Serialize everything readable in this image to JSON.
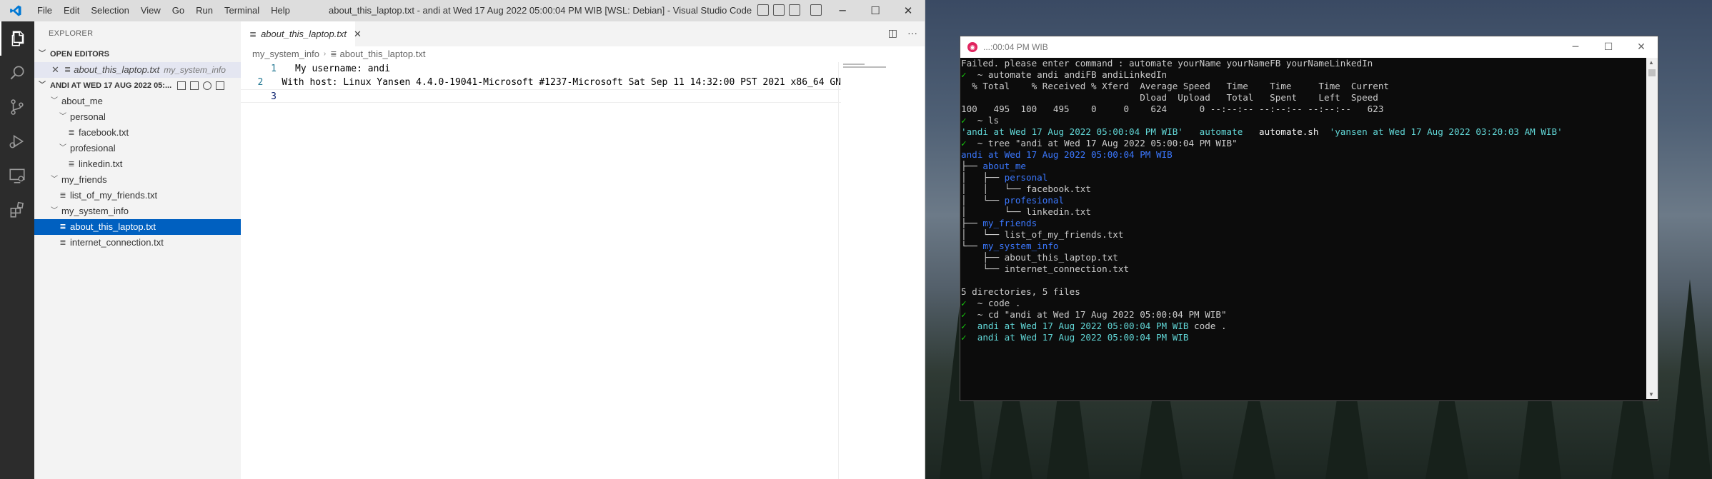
{
  "vscode": {
    "title": "about_this_laptop.txt - andi at Wed 17 Aug 2022 05:00:04 PM WIB [WSL: Debian] - Visual Studio Code",
    "menu": [
      "File",
      "Edit",
      "Selection",
      "View",
      "Go",
      "Run",
      "Terminal",
      "Help"
    ],
    "sidebar": {
      "header": "EXPLORER",
      "open_editors_label": "OPEN EDITORS",
      "open_editor": {
        "name": "about_this_laptop.txt",
        "desc": "my_system_info"
      },
      "folder_label": "ANDI AT WED 17 AUG 2022 05:...",
      "tree": [
        {
          "label": "about_me",
          "type": "folder",
          "depth": 1
        },
        {
          "label": "personal",
          "type": "folder",
          "depth": 2
        },
        {
          "label": "facebook.txt",
          "type": "file",
          "depth": 3
        },
        {
          "label": "profesional",
          "type": "folder",
          "depth": 2
        },
        {
          "label": "linkedin.txt",
          "type": "file",
          "depth": 3
        },
        {
          "label": "my_friends",
          "type": "folder",
          "depth": 1
        },
        {
          "label": "list_of_my_friends.txt",
          "type": "file",
          "depth": 2
        },
        {
          "label": "my_system_info",
          "type": "folder",
          "depth": 1
        },
        {
          "label": "about_this_laptop.txt",
          "type": "file",
          "depth": 2,
          "selected": true
        },
        {
          "label": "internet_connection.txt",
          "type": "file",
          "depth": 2
        }
      ]
    },
    "editor": {
      "tab_label": "about_this_laptop.txt",
      "breadcrumb": [
        "my_system_info",
        "about_this_laptop.txt"
      ],
      "lines": [
        {
          "num": "1",
          "text": "My username: andi"
        },
        {
          "num": "2",
          "text": "With host: Linux Yansen 4.4.0-19041-Microsoft #1237-Microsoft Sat Sep 11 14:32:00 PST 2021 x86_64 GN"
        },
        {
          "num": "3",
          "text": ""
        }
      ]
    }
  },
  "terminal": {
    "title": "...:00:04 PM WIB",
    "lines": [
      [
        {
          "t": "Failed. please enter command : automate yourName yourNameFB yourNameLinkedIn",
          "c": ""
        }
      ],
      [
        {
          "t": "✓",
          "c": "g"
        },
        {
          "t": "  ~ automate andi andiFB andiLinkedIn",
          "c": ""
        }
      ],
      [
        {
          "t": "  % Total    % Received % Xferd  Average Speed   Time    Time     Time  Current",
          "c": ""
        }
      ],
      [
        {
          "t": "                                 Dload  Upload   Total   Spent    Left  Speed",
          "c": ""
        }
      ],
      [
        {
          "t": "100   495  100   495    0     0    624      0 --:--:-- --:--:-- --:--:--   623",
          "c": ""
        }
      ],
      [
        {
          "t": "✓",
          "c": "g"
        },
        {
          "t": "  ~ ls",
          "c": ""
        }
      ],
      [
        {
          "t": "'andi at Wed 17 Aug 2022 05:00:04 PM WIB'",
          "c": "c"
        },
        {
          "t": "   ",
          "c": ""
        },
        {
          "t": "automate",
          "c": "c"
        },
        {
          "t": "   automate.sh  ",
          "c": "w"
        },
        {
          "t": "'yansen at Wed 17 Aug 2022 03:20:03 AM WIB'",
          "c": "c"
        }
      ],
      [
        {
          "t": "✓",
          "c": "g"
        },
        {
          "t": "  ~ tree \"andi at Wed 17 Aug 2022 05:00:04 PM WIB\"",
          "c": ""
        }
      ],
      [
        {
          "t": "andi at Wed 17 Aug 2022 05:00:04 PM WIB",
          "c": "b"
        }
      ],
      [
        {
          "t": "├── ",
          "c": ""
        },
        {
          "t": "about_me",
          "c": "b"
        }
      ],
      [
        {
          "t": "│   ├── ",
          "c": ""
        },
        {
          "t": "personal",
          "c": "b"
        }
      ],
      [
        {
          "t": "│   │   └── facebook.txt",
          "c": ""
        }
      ],
      [
        {
          "t": "│   └── ",
          "c": ""
        },
        {
          "t": "profesional",
          "c": "b"
        }
      ],
      [
        {
          "t": "│       └── linkedin.txt",
          "c": ""
        }
      ],
      [
        {
          "t": "├── ",
          "c": ""
        },
        {
          "t": "my_friends",
          "c": "b"
        }
      ],
      [
        {
          "t": "│   └── list_of_my_friends.txt",
          "c": ""
        }
      ],
      [
        {
          "t": "└── ",
          "c": ""
        },
        {
          "t": "my_system_info",
          "c": "b"
        }
      ],
      [
        {
          "t": "    ├── about_this_laptop.txt",
          "c": ""
        }
      ],
      [
        {
          "t": "    └── internet_connection.txt",
          "c": ""
        }
      ],
      [
        {
          "t": "",
          "c": ""
        }
      ],
      [
        {
          "t": "5 directories, 5 files",
          "c": ""
        }
      ],
      [
        {
          "t": "✓",
          "c": "g"
        },
        {
          "t": "  ~ code .",
          "c": ""
        }
      ],
      [
        {
          "t": "✓",
          "c": "g"
        },
        {
          "t": "  ~ cd \"andi at Wed 17 Aug 2022 05:00:04 PM WIB\"",
          "c": ""
        }
      ],
      [
        {
          "t": "✓",
          "c": "g"
        },
        {
          "t": "  andi at Wed 17 Aug 2022 05:00:04 PM WIB",
          "c": "c"
        },
        {
          "t": " code .",
          "c": ""
        }
      ],
      [
        {
          "t": "✓",
          "c": "g"
        },
        {
          "t": "  andi at Wed 17 Aug 2022 05:00:04 PM WIB",
          "c": "c"
        }
      ]
    ]
  }
}
